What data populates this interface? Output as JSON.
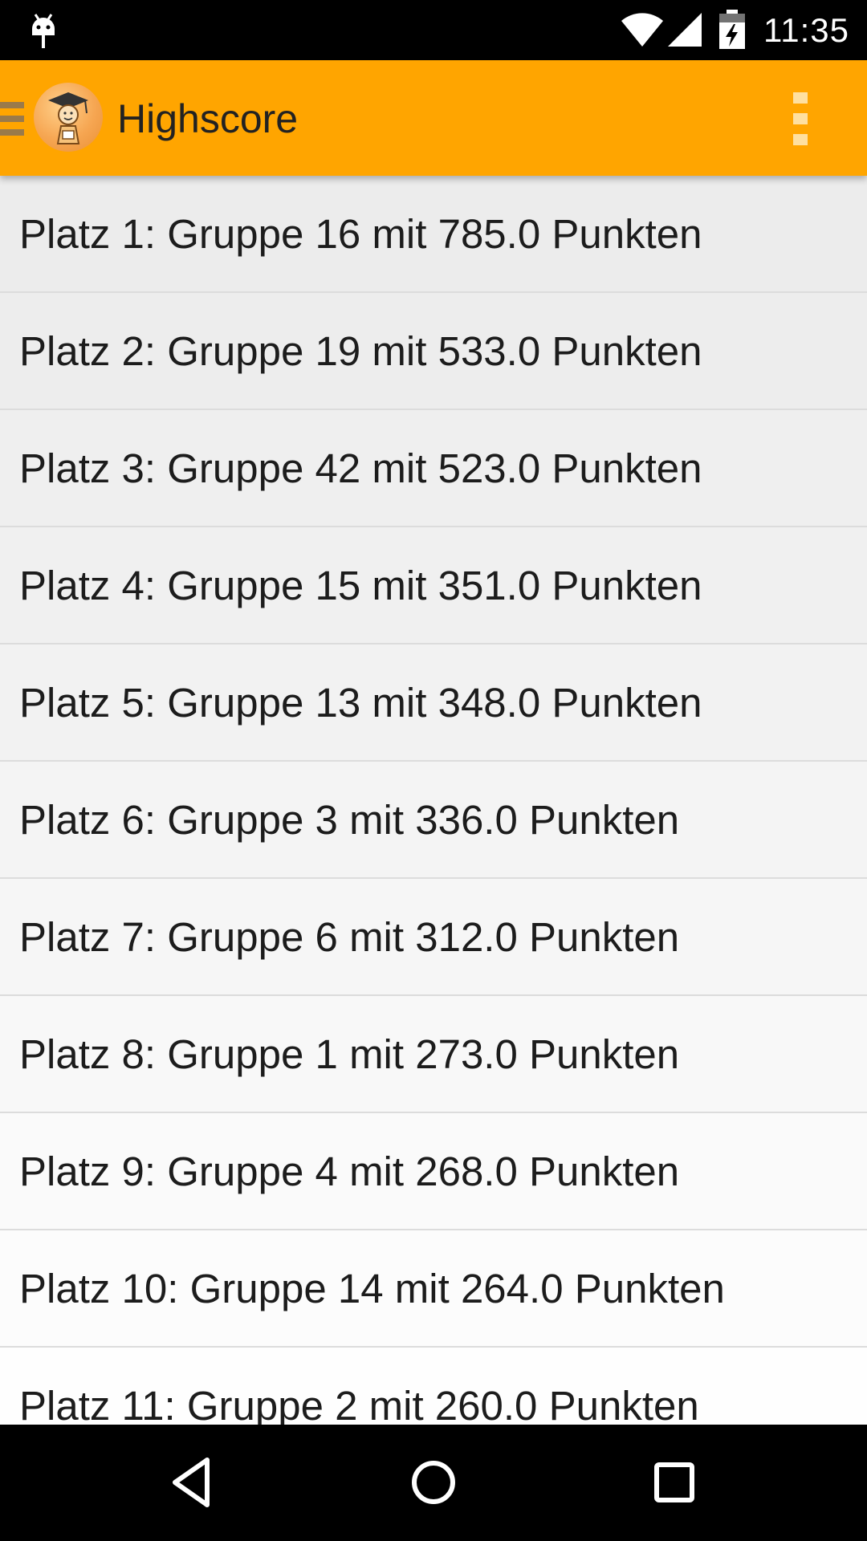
{
  "status_bar": {
    "time": "11:35",
    "icons": [
      "android-debug-icon",
      "wifi-icon",
      "cell-signal-icon",
      "battery-charging-icon"
    ]
  },
  "action_bar": {
    "title": "Highscore",
    "background_color": "#ffa500",
    "icons": [
      "drawer-menu-icon",
      "app-logo-icon",
      "overflow-menu-icon"
    ]
  },
  "highscore_list": [
    {
      "label": "Platz 1: Gruppe 16 mit 785.0 Punkten",
      "bg": "#ececec"
    },
    {
      "label": "Platz 2: Gruppe 19 mit 533.0 Punkten",
      "bg": "#ededed"
    },
    {
      "label": "Platz 3: Gruppe 42 mit 523.0 Punkten",
      "bg": "#efefef"
    },
    {
      "label": "Platz 4: Gruppe 15 mit 351.0 Punkten",
      "bg": "#f0f0f0"
    },
    {
      "label": "Platz 5: Gruppe 13 mit 348.0 Punkten",
      "bg": "#f2f2f2"
    },
    {
      "label": "Platz 6: Gruppe 3 mit 336.0 Punkten",
      "bg": "#f4f4f4"
    },
    {
      "label": "Platz 7: Gruppe 6 mit 312.0 Punkten",
      "bg": "#f6f6f6"
    },
    {
      "label": "Platz 8: Gruppe 1 mit 273.0 Punkten",
      "bg": "#f8f8f8"
    },
    {
      "label": "Platz 9: Gruppe 4 mit 268.0 Punkten",
      "bg": "#fafafa"
    },
    {
      "label": "Platz 10: Gruppe 14 mit 264.0 Punkten",
      "bg": "#fcfcfc"
    },
    {
      "label": "Platz 11: Gruppe 2 mit 260.0 Punkten",
      "bg": "#fefefe"
    }
  ],
  "nav_bar": {
    "icons": [
      "back-icon",
      "home-icon",
      "recents-icon"
    ]
  }
}
